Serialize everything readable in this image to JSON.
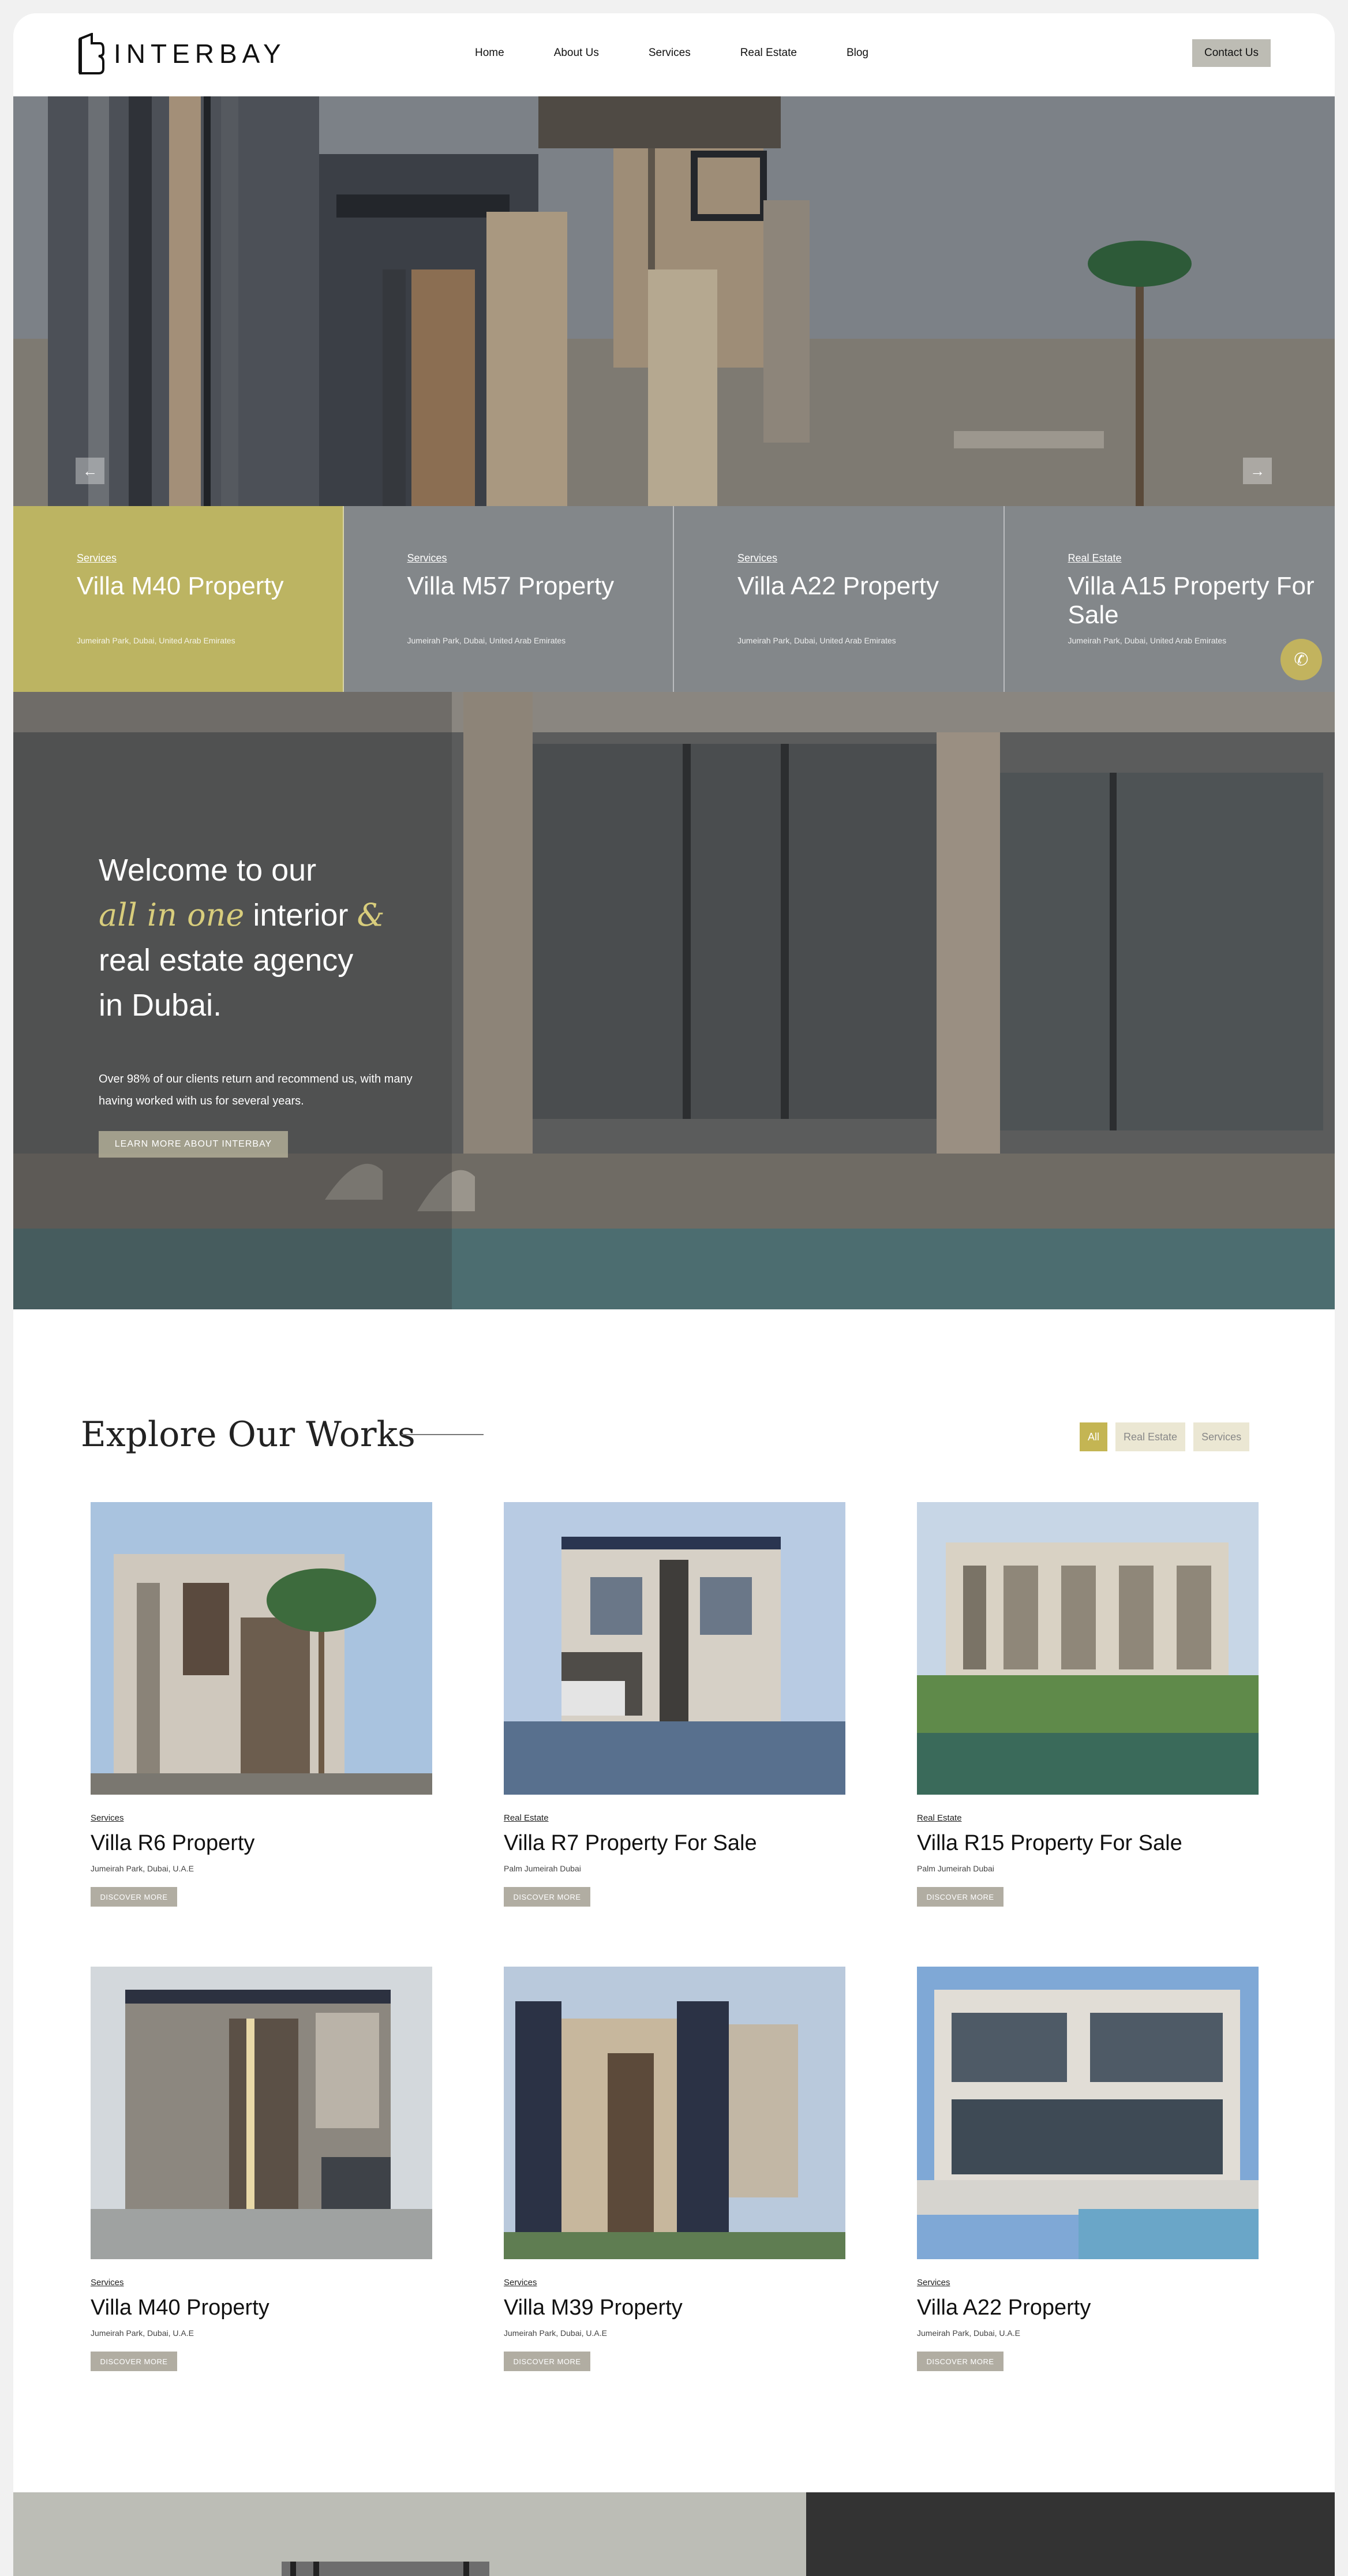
{
  "header": {
    "logo_text": "INTERBAY",
    "nav": [
      "Home",
      "About Us",
      "Services",
      "Real Estate",
      "Blog"
    ],
    "contact_label": "Contact Us"
  },
  "hero": {
    "prev_icon": "arrow-left-icon",
    "next_icon": "arrow-right-icon"
  },
  "cards": [
    {
      "category": "Services",
      "title": "Villa M40 Property",
      "location": "Jumeirah Park, Dubai, United Arab Emirates"
    },
    {
      "category": "Services",
      "title": "Villa M57 Property",
      "location": "Jumeirah Park, Dubai, United Arab Emirates"
    },
    {
      "category": "Services",
      "title": "Villa A22 Property",
      "location": "Jumeirah Park, Dubai, United Arab Emirates"
    },
    {
      "category": "Real Estate",
      "title": "Villa A15 Property For Sale",
      "location": "Jumeirah Park, Dubai, United Arab Emirates"
    }
  ],
  "welcome": {
    "line1": "Welcome to our",
    "accent": "all in one",
    "line2_rest": "interior",
    "ampersand": "&",
    "line3": "real estate agency",
    "line4": "in Dubai.",
    "paragraph": "Over 98% of our clients return and recommend us, with many having worked with us for several years.",
    "button": "LEARN MORE ABOUT INTERBAY"
  },
  "explore": {
    "title": "Explore Our Works",
    "filters": [
      "All",
      "Real Estate",
      "Services"
    ],
    "works": [
      {
        "category": "Services",
        "title": "Villa R6 Property",
        "location": "Jumeirah Park, Dubai, U.A.E",
        "button": "DISCOVER MORE"
      },
      {
        "category": "Real Estate",
        "title": "Villa R7 Property For Sale",
        "location": "Palm Jumeirah Dubai",
        "button": "DISCOVER MORE"
      },
      {
        "category": "Real Estate",
        "title": "Villa R15 Property For Sale",
        "location": "Palm Jumeirah Dubai",
        "button": "DISCOVER MORE"
      },
      {
        "category": "Services",
        "title": "Villa M40 Property",
        "location": "Jumeirah Park, Dubai, U.A.E",
        "button": "DISCOVER MORE"
      },
      {
        "category": "Services",
        "title": "Villa M39 Property",
        "location": "Jumeirah Park, Dubai, U.A.E",
        "button": "DISCOVER MORE"
      },
      {
        "category": "Services",
        "title": "Villa A22 Property",
        "location": "Jumeirah Park, Dubai, U.A.E",
        "button": "DISCOVER MORE"
      }
    ]
  },
  "colors": {
    "accent_gold": "#bcb462",
    "button_grey": "#b1ada2",
    "dark": "#333333"
  }
}
